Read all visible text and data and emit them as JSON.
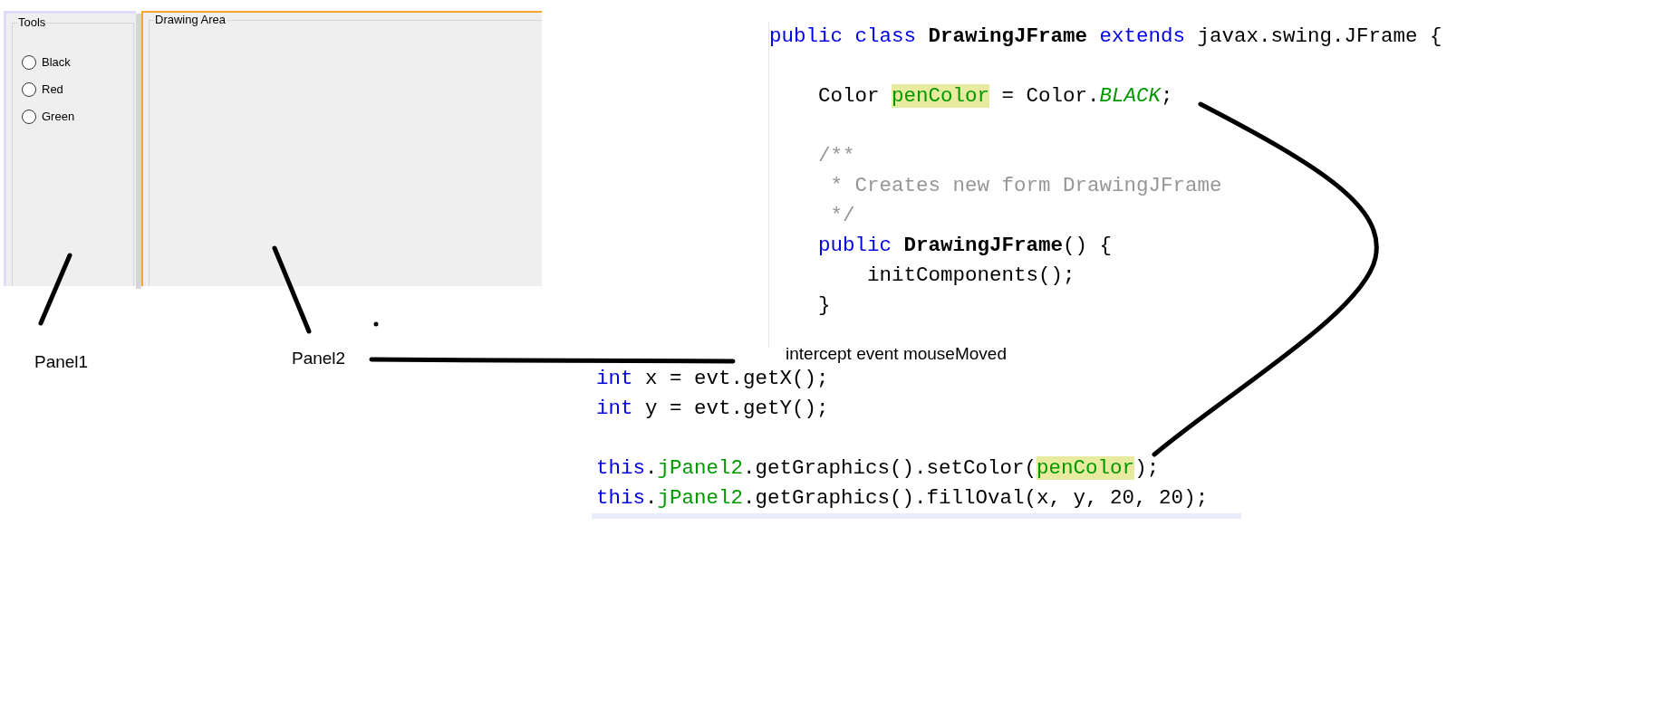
{
  "designer": {
    "tools_panel": {
      "title": "Tools",
      "options": [
        {
          "label": "Black",
          "selected": false
        },
        {
          "label": "Red",
          "selected": false
        },
        {
          "label": "Green",
          "selected": false
        }
      ]
    },
    "drawing_panel": {
      "title": "Drawing Area"
    }
  },
  "annotations": {
    "panel1": "Panel1",
    "panel2": "Panel2",
    "event": "intercept event mouseMoved"
  },
  "code_blocks": [
    {
      "kind": "class",
      "lines": [
        {
          "kind": "code",
          "segments": [
            {
              "text": "public class ",
              "kind": "keyword"
            },
            {
              "text": "DrawingJFrame ",
              "kind": "bold"
            },
            {
              "text": "extends",
              "kind": "keyword"
            },
            {
              "text": " javax.swing.JFrame {",
              "kind": "plain"
            }
          ]
        },
        {
          "kind": "blank"
        },
        {
          "kind": "code",
          "segments": [
            {
              "text": "    Color ",
              "kind": "plain"
            },
            {
              "text": "penColor",
              "kind": "marked-field"
            },
            {
              "text": " = Color.",
              "kind": "plain"
            },
            {
              "text": "BLACK",
              "kind": "constant"
            },
            {
              "text": ";",
              "kind": "plain"
            }
          ]
        },
        {
          "kind": "blank"
        },
        {
          "kind": "code",
          "segments": [
            {
              "text": "    /**",
              "kind": "comment"
            }
          ]
        },
        {
          "kind": "code",
          "segments": [
            {
              "text": "     * Creates new form DrawingJFrame",
              "kind": "comment"
            }
          ]
        },
        {
          "kind": "code",
          "segments": [
            {
              "text": "     */",
              "kind": "comment"
            }
          ]
        },
        {
          "kind": "code",
          "segments": [
            {
              "text": "    public ",
              "kind": "keyword"
            },
            {
              "text": "DrawingJFrame",
              "kind": "bold"
            },
            {
              "text": "() {",
              "kind": "plain"
            }
          ]
        },
        {
          "kind": "code",
          "segments": [
            {
              "text": "        initComponents();",
              "kind": "plain"
            }
          ]
        },
        {
          "kind": "code",
          "segments": [
            {
              "text": "    }",
              "kind": "plain"
            }
          ]
        }
      ]
    },
    {
      "kind": "handler",
      "lines": [
        {
          "kind": "code",
          "segments": [
            {
              "text": "int",
              "kind": "keyword"
            },
            {
              "text": " x = evt.getX();",
              "kind": "plain"
            }
          ]
        },
        {
          "kind": "code",
          "segments": [
            {
              "text": "int",
              "kind": "keyword"
            },
            {
              "text": " y = evt.getY();",
              "kind": "plain"
            }
          ]
        },
        {
          "kind": "blank"
        },
        {
          "kind": "code",
          "segments": [
            {
              "text": "this",
              "kind": "keyword"
            },
            {
              "text": ".",
              "kind": "plain"
            },
            {
              "text": "jPanel2",
              "kind": "field"
            },
            {
              "text": ".getGraphics().setColor(",
              "kind": "plain"
            },
            {
              "text": "penColor",
              "kind": "marked-field"
            },
            {
              "text": ");",
              "kind": "plain"
            }
          ]
        },
        {
          "kind": "code",
          "segments": [
            {
              "text": "this",
              "kind": "keyword"
            },
            {
              "text": ".",
              "kind": "plain"
            },
            {
              "text": "jPanel2",
              "kind": "field"
            },
            {
              "text": ".getGraphics().fillOval(x, y, 20, 20);",
              "kind": "plain"
            }
          ]
        }
      ]
    }
  ]
}
